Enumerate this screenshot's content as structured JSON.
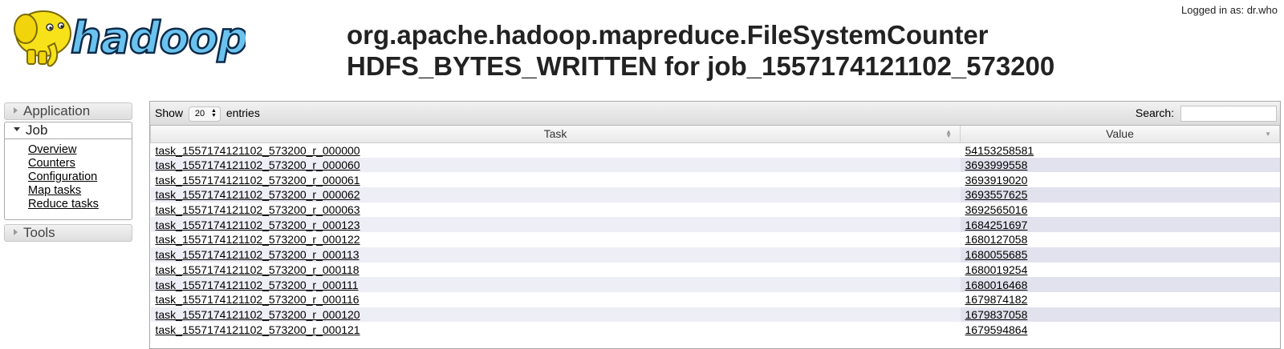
{
  "header": {
    "logo_text": "hadoop",
    "logged_in": "Logged in as: dr.who",
    "title_line1": "org.apache.hadoop.mapreduce.FileSystemCounter",
    "title_line2": "HDFS_BYTES_WRITTEN for job_1557174121102_573200"
  },
  "nav": {
    "application": "Application",
    "job": "Job",
    "job_links": [
      "Overview",
      "Counters",
      "Configuration",
      "Map tasks",
      "Reduce tasks"
    ],
    "tools": "Tools"
  },
  "table": {
    "show_label": "Show",
    "entries_label": "entries",
    "page_length": "20",
    "search_label": "Search:",
    "search_value": "",
    "columns": [
      "Task",
      "Value"
    ],
    "rows": [
      {
        "task": "task_1557174121102_573200_r_000000",
        "value": "54153258581"
      },
      {
        "task": "task_1557174121102_573200_r_000060",
        "value": "3693999558"
      },
      {
        "task": "task_1557174121102_573200_r_000061",
        "value": "3693919020"
      },
      {
        "task": "task_1557174121102_573200_r_000062",
        "value": "3693557625"
      },
      {
        "task": "task_1557174121102_573200_r_000063",
        "value": "3692565016"
      },
      {
        "task": "task_1557174121102_573200_r_000123",
        "value": "1684251697"
      },
      {
        "task": "task_1557174121102_573200_r_000122",
        "value": "1680127058"
      },
      {
        "task": "task_1557174121102_573200_r_000113",
        "value": "1680055685"
      },
      {
        "task": "task_1557174121102_573200_r_000118",
        "value": "1680019254"
      },
      {
        "task": "task_1557174121102_573200_r_000111",
        "value": "1680016468"
      },
      {
        "task": "task_1557174121102_573200_r_000116",
        "value": "1679874182"
      },
      {
        "task": "task_1557174121102_573200_r_000120",
        "value": "1679837058"
      },
      {
        "task": "task_1557174121102_573200_r_000121",
        "value": "1679594864"
      }
    ]
  }
}
